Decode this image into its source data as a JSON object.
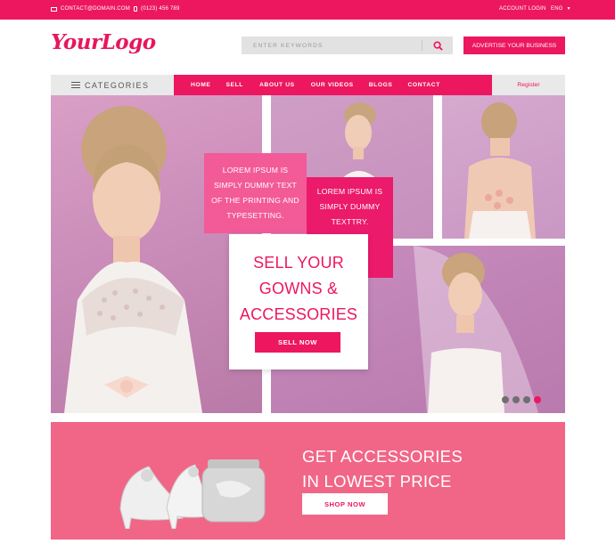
{
  "topbar": {
    "email": "CONTACT@DOMAIN.COM",
    "phone": "(0123) 456 789",
    "account_login": "ACCOUNT LOGIN",
    "language": "ENG"
  },
  "header": {
    "logo_text": "YourLogo",
    "search_placeholder": "ENTER KEYWORDS",
    "advertise_label": "ADVERTISE YOUR BUSINESS"
  },
  "nav": {
    "categories_label": "CATEGORIES",
    "links": [
      "HOME",
      "SELL",
      "ABOUT US",
      "OUR VIDEOS",
      "BLOGS",
      "CONTACT"
    ],
    "register_label": "Register"
  },
  "hero": {
    "box1_text": "LOREM IPSUM IS SIMPLY DUMMY TEXT OF THE PRINTING AND TYPESETTING.",
    "box2_text": "LOREM IPSUM IS SIMPLY DUMMY TEXTTRY.",
    "sell_title": "SELL YOUR GOWNS & ACCESSORIES",
    "sell_button": "SELL NOW",
    "slides": 4,
    "active_slide": 4
  },
  "promo": {
    "title_line1": "GET ACCESSORIES",
    "title_line2": "IN LOWEST PRICE",
    "shop_button": "SHOP NOW"
  },
  "colors": {
    "brand_pink": "#ec175f",
    "promo_pink": "#f16687",
    "light_gray": "#e9e9e9"
  }
}
